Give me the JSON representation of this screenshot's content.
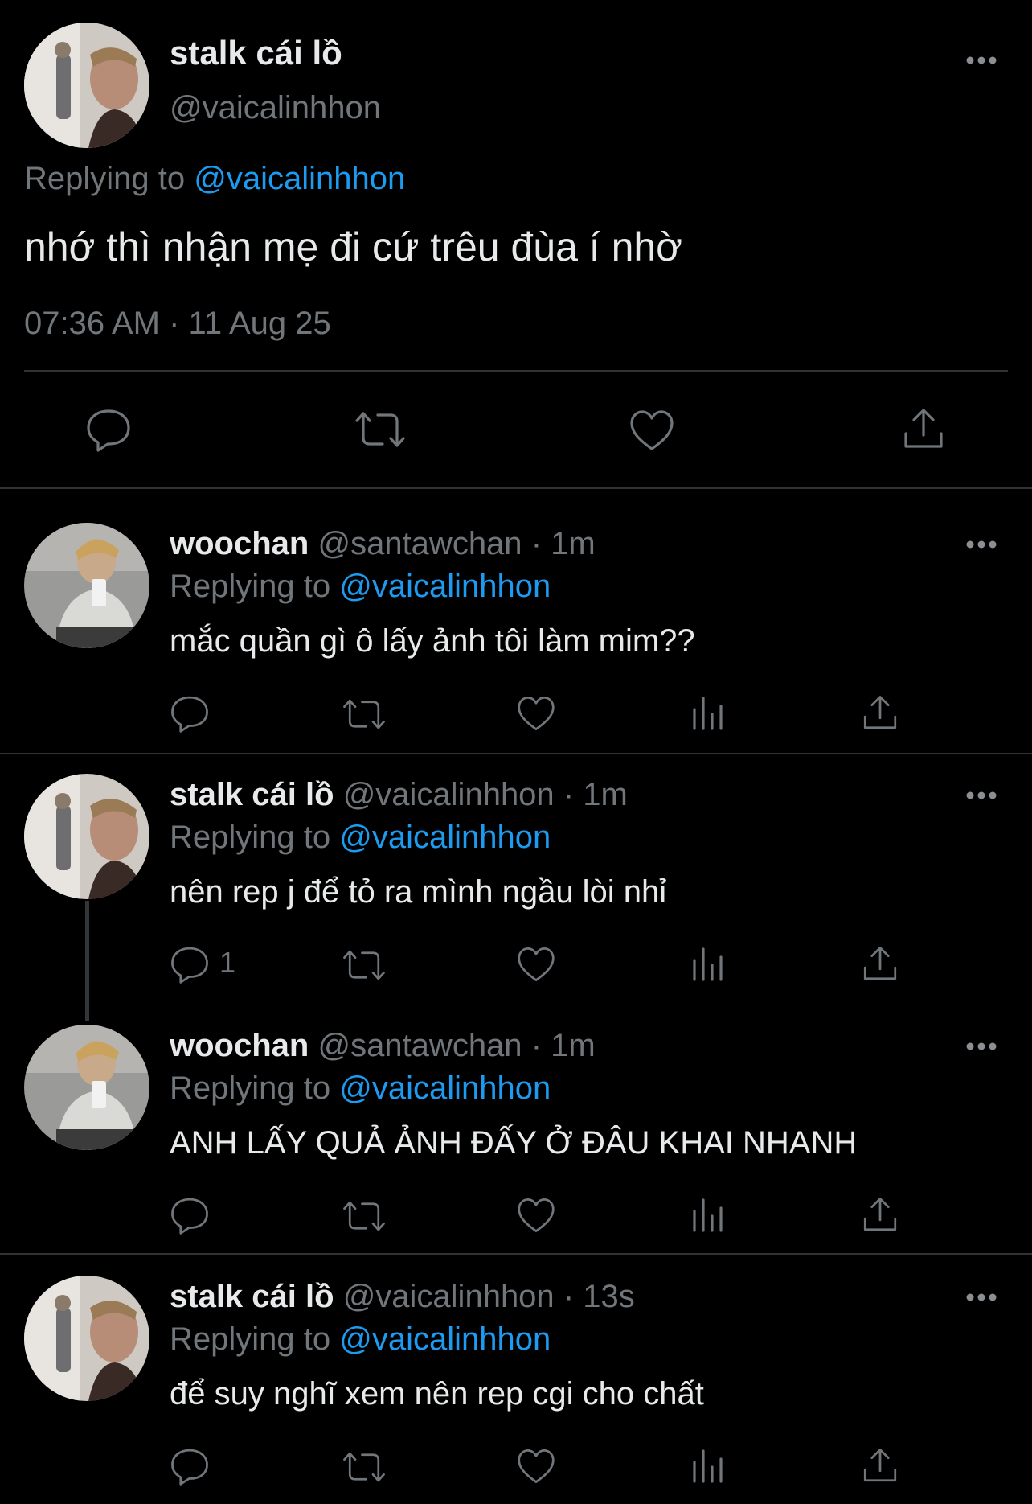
{
  "main_tweet": {
    "display_name": "stalk cái lồ",
    "handle": "@vaicalinhhon",
    "replying_prefix": "Replying to",
    "replying_handle": "@vaicalinhhon",
    "text": "nhớ thì nhận mẹ đi cứ trêu đùa í nhờ",
    "timestamp": "07:36 AM · 11 Aug 25",
    "avatar_icon": "avatar-man-icon"
  },
  "replies": [
    {
      "display_name": "woochan",
      "handle": "@santawchan",
      "time": "· 1m",
      "replying_prefix": "Replying to",
      "replying_handle": "@vaicalinhhon",
      "text": "mắc quần gì ô lấy ảnh tôi làm mim??",
      "reply_count": ""
    },
    {
      "display_name": "stalk cái lồ",
      "handle": "@vaicalinhhon",
      "time": "· 1m",
      "replying_prefix": "Replying to",
      "replying_handle": "@vaicalinhhon",
      "text": "nên rep j để tỏ ra mình ngầu lòi nhỉ",
      "reply_count": "1"
    },
    {
      "display_name": "woochan",
      "handle": "@santawchan",
      "time": "· 1m",
      "replying_prefix": "Replying to",
      "replying_handle": "@vaicalinhhon",
      "text": "ANH LẤY QUẢ ẢNH ĐẤY Ở ĐÂU KHAI NHANH",
      "reply_count": ""
    },
    {
      "display_name": "stalk cái lồ",
      "handle": "@vaicalinhhon",
      "time": "· 13s",
      "replying_prefix": "Replying to",
      "replying_handle": "@vaicalinhhon",
      "text": "để suy nghĩ xem nên rep cgi cho chất",
      "reply_count": ""
    }
  ],
  "colors": {
    "background": "#000000",
    "text": "#e7e9ea",
    "secondary": "#71767b",
    "link": "#1d9bf0",
    "divider": "#2f3336"
  }
}
